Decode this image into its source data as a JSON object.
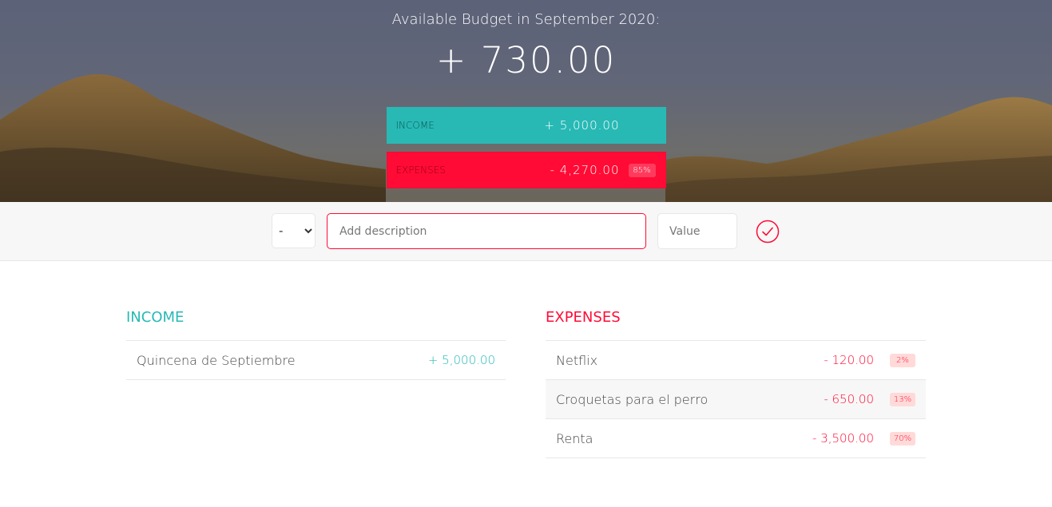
{
  "budget": {
    "title": "Available Budget in September 2020:",
    "value": "+ 730.00",
    "income_label": "Income",
    "income_value": "+ 5,000.00",
    "expenses_label": "Expenses",
    "expenses_value": "- 4,270.00",
    "expenses_percentage": "85%"
  },
  "add": {
    "type_selected": "-",
    "type_options": [
      "+",
      "-"
    ],
    "description_placeholder": "Add description",
    "value_placeholder": "Value",
    "submit_icon": "checkmark-circle-icon"
  },
  "income": {
    "title": "Income",
    "items": [
      {
        "description": "Quincena de Septiembre",
        "value": "+ 5,000.00"
      }
    ]
  },
  "expenses": {
    "title": "Expenses",
    "items": [
      {
        "description": "Netflix",
        "value": "- 120.00",
        "percentage": "2%"
      },
      {
        "description": "Croquetas para el perro",
        "value": "- 650.00",
        "percentage": "13%"
      },
      {
        "description": "Renta",
        "value": "- 3,500.00",
        "percentage": "70%"
      }
    ]
  },
  "colors": {
    "income": "#28B9B5",
    "expenses": "#ff0b35"
  }
}
